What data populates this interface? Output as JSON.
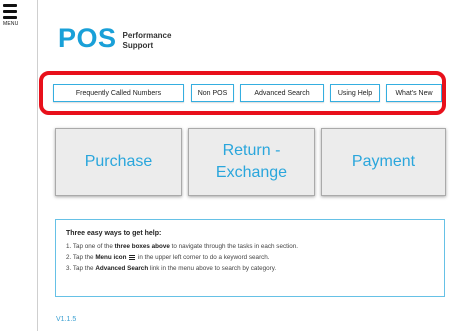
{
  "menu": {
    "label": "MENU",
    "icon": "hamburger-icon"
  },
  "logo": {
    "main": "POS",
    "sub_line1": "Performance",
    "sub_line2": "Support",
    "color": "#19a0d8"
  },
  "nav_links": [
    {
      "label": "Frequently Called Numbers"
    },
    {
      "label": "Non POS"
    },
    {
      "label": "Advanced Search"
    },
    {
      "label": "Using Help"
    },
    {
      "label": "What's New"
    }
  ],
  "nav_highlight_color": "#e8101b",
  "task_boxes": [
    {
      "line1": "Purchase",
      "line2": ""
    },
    {
      "line1": "Return -",
      "line2": "Exchange"
    },
    {
      "line1": "Payment",
      "line2": ""
    }
  ],
  "help": {
    "title": "Three easy ways to get help:",
    "items": [
      {
        "num": "1.",
        "pre": "Tap one of the",
        "bold": "three boxes above",
        "post": "to navigate through the tasks in each section."
      },
      {
        "num": "2.",
        "pre": "Tap the",
        "bold": "Menu icon",
        "post": "in the upper left corner to do a keyword search."
      },
      {
        "num": "3.",
        "pre": "Tap the",
        "bold": "Advanced Search",
        "post": "link in the menu above to search by category."
      }
    ]
  },
  "version": "V1.1.5"
}
